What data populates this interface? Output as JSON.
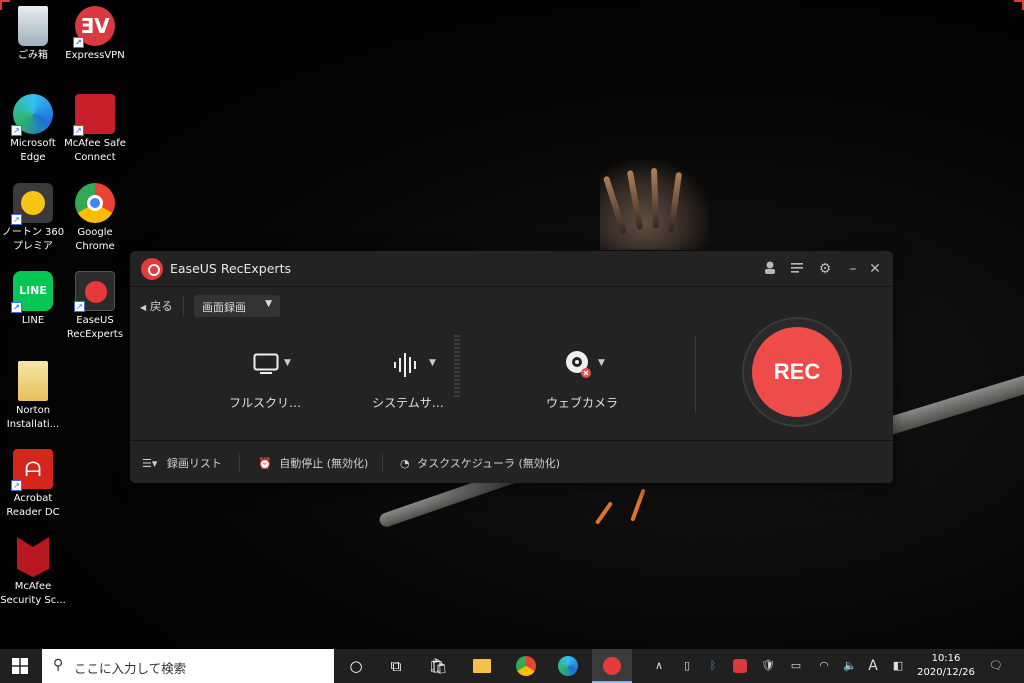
{
  "desktop": {
    "icons": [
      {
        "label": "ごみ箱",
        "icon": "recycle-bin-icon"
      },
      {
        "label": "ExpressVPN",
        "icon": "expressvpn-icon"
      },
      {
        "label": "Microsoft Edge",
        "icon": "edge-icon"
      },
      {
        "label": "McAfee Safe Connect",
        "icon": "mcafee-safe-connect-icon"
      },
      {
        "label": "ノートン 360 プレミア",
        "icon": "norton-360-icon"
      },
      {
        "label": "Google Chrome",
        "icon": "chrome-icon"
      },
      {
        "label": "LINE",
        "icon": "line-icon"
      },
      {
        "label": "EaseUS RecExperts",
        "icon": "easeus-recexperts-icon"
      },
      {
        "label": "Norton Installati...",
        "icon": "norton-installer-icon"
      },
      {
        "label": "Acrobat Reader DC",
        "icon": "acrobat-icon"
      },
      {
        "label": "McAfee Security Sc...",
        "icon": "mcafee-security-icon"
      }
    ]
  },
  "app": {
    "title": "EaseUS RecExperts",
    "back_label": "戻る",
    "mode_value": "画面録画",
    "options": {
      "screen_label": "フルスクリ…",
      "audio_label": "システムサ…",
      "webcam_label": "ウェブカメラ"
    },
    "rec_label": "REC",
    "bottom": {
      "list_label": "録画リスト",
      "auto_stop_label": "自動停止 (無効化)",
      "scheduler_label": "タスクスケジューラ (無効化)"
    },
    "colors": {
      "accent": "#ee4b4b",
      "window_bg": "#232324"
    }
  },
  "taskbar": {
    "search_placeholder": "ここに入力して検索",
    "ime_label": "A",
    "time": "10:16",
    "date": "2020/12/26"
  }
}
